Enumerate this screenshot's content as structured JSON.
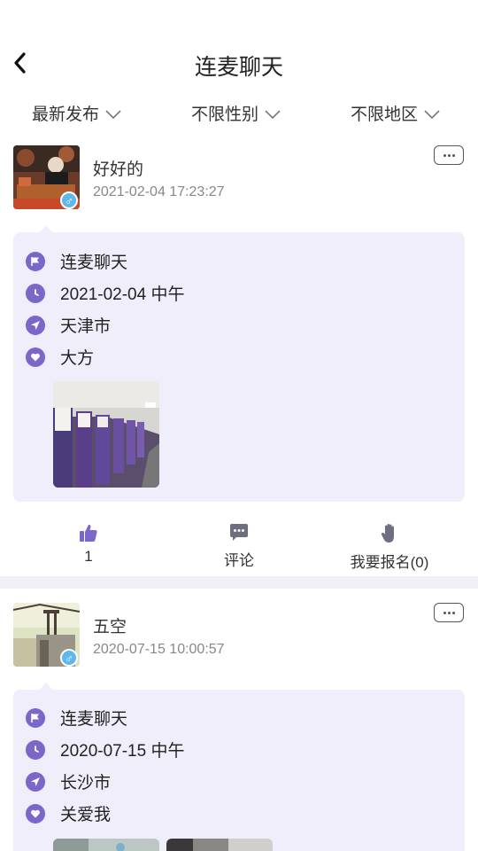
{
  "header": {
    "title": "连麦聊天"
  },
  "filters": [
    {
      "label": "最新发布"
    },
    {
      "label": "不限性别"
    },
    {
      "label": "不限地区"
    }
  ],
  "posts": [
    {
      "username": "好好的",
      "posted_at": "2021-02-04 17:23:27",
      "gender_symbol": "♂",
      "info": {
        "topic": "连麦聊天",
        "when": "2021-02-04 中午",
        "city": "天津市",
        "requirement": "大方"
      },
      "likes": "1",
      "comment_label": "评论",
      "signup_label": "我要报名(0)"
    },
    {
      "username": "五空",
      "posted_at": "2020-07-15 10:00:57",
      "gender_symbol": "♂",
      "info": {
        "topic": "连麦聊天",
        "when": "2020-07-15 中午",
        "city": "长沙市",
        "requirement": "关爱我"
      }
    }
  ],
  "colors": {
    "accent": "#7a67c9",
    "card_bg": "#efeefa",
    "gender_male": "#5fb7ea"
  }
}
